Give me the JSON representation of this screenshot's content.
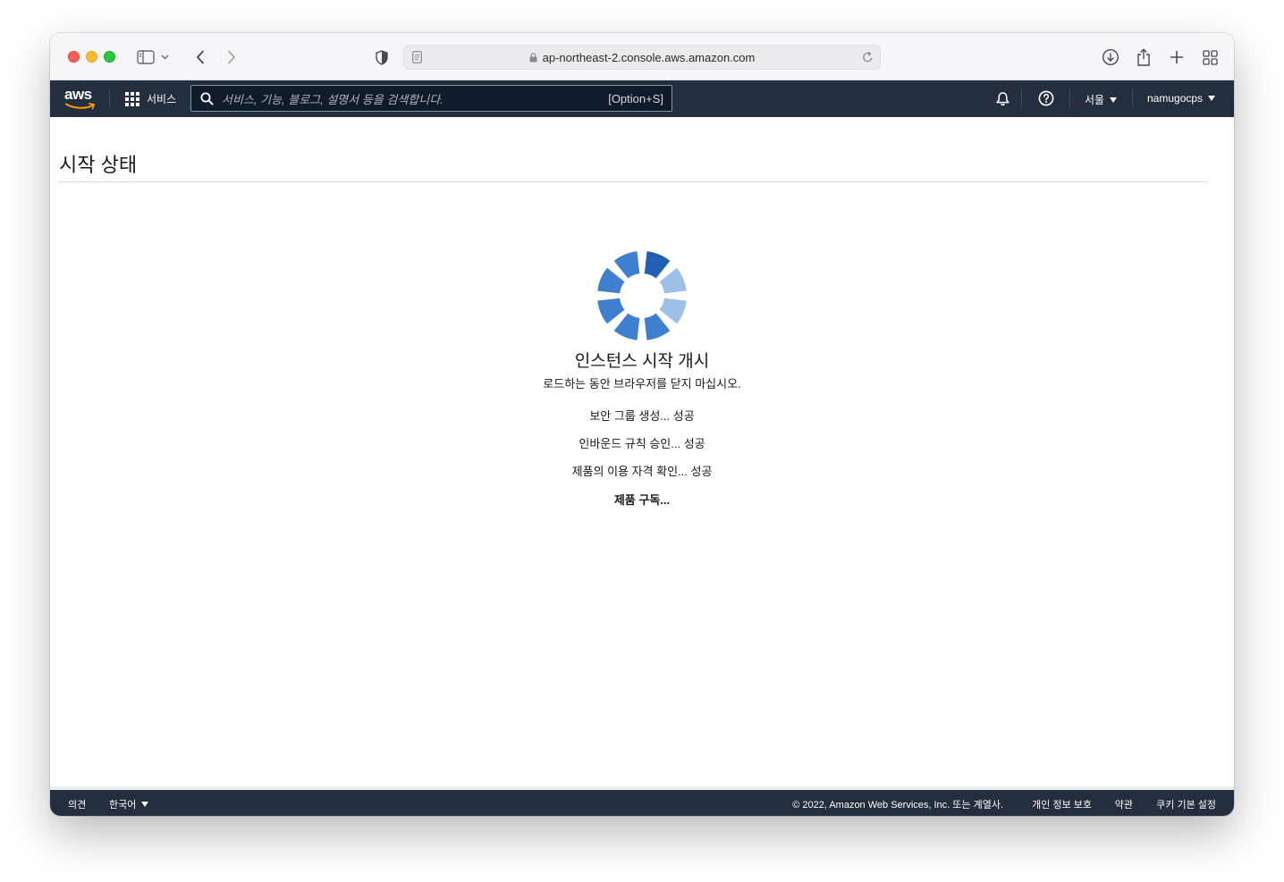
{
  "browser": {
    "url": "ap-northeast-2.console.aws.amazon.com",
    "icons": [
      "sidebar-icon",
      "chevron-down-icon",
      "back-icon",
      "forward-icon",
      "shield-icon",
      "page-icon",
      "lock-icon",
      "reload-icon",
      "download-icon",
      "share-icon",
      "new-tab-icon",
      "tab-overview-icon"
    ]
  },
  "nav": {
    "logo": "aws",
    "services": "서비스",
    "search_placeholder": "서비스, 기능, 블로그, 설명서 등을 검색합니다.",
    "search_shortcut": "[Option+S]",
    "region": "서울",
    "account": "namugocps"
  },
  "page": {
    "title": "시작 상태",
    "launch_title": "인스턴스 시작 개시",
    "launch_subtitle": "로드하는 동안 브라우저를 닫지 마십시오.",
    "steps": [
      {
        "text": "보안 그룹 생성... 성공",
        "state": "done"
      },
      {
        "text": "인바운드 규칙 승인... 성공",
        "state": "done"
      },
      {
        "text": "제품의 이용 자격 확인... 성공",
        "state": "done"
      },
      {
        "text": "제품 구독...",
        "state": "in-progress"
      }
    ]
  },
  "footer": {
    "feedback": "의견",
    "language": "한국어",
    "copyright": "© 2022, Amazon Web Services, Inc. 또는 계열사.",
    "privacy": "개인 정보 보호",
    "terms": "약관",
    "cookies": "쿠키 기본 설정"
  },
  "colors": {
    "nav_bg": "#232f3e",
    "spinner_dark": "#1f5fb4",
    "spinner_mid": "#3f7fcf",
    "spinner_light": "#9cc0e8"
  }
}
